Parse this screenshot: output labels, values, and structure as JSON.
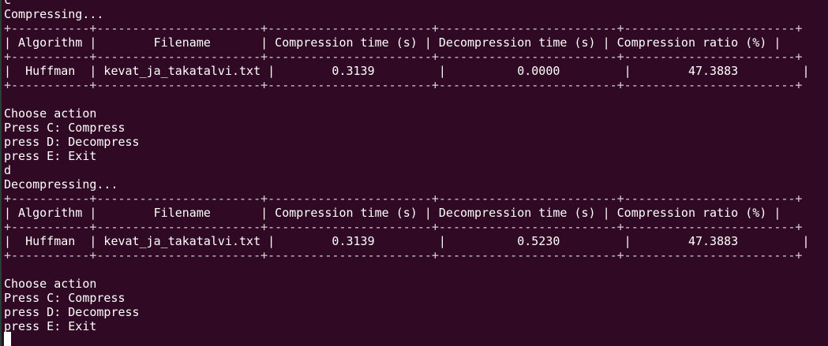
{
  "terminal": {
    "lines": [
      "c",
      "Compressing...",
      "+-----------+-----------------------+-----------------------+-------------------------+------------------------+",
      "| Algorithm |        Filename       | Compression time (s) | Decompression time (s) | Compression ratio (%) |",
      "+-----------+-----------------------+-----------------------+-------------------------+------------------------+",
      "|  Huffman  | kevat_ja_takatalvi.txt |        0.3139         |          0.0000         |        47.3883         |",
      "+-----------+-----------------------+-----------------------+-------------------------+------------------------+",
      "",
      "Choose action",
      "Press C: Compress",
      "press D: Decompress",
      "press E: Exit",
      "d",
      "Decompressing...",
      "+-----------+-----------------------+-----------------------+-------------------------+------------------------+",
      "| Algorithm |        Filename       | Compression time (s) | Decompression time (s) | Compression ratio (%) |",
      "+-----------+-----------------------+-----------------------+-------------------------+------------------------+",
      "|  Huffman  | kevat_ja_takatalvi.txt |        0.3139         |          0.5230         |        47.3883         |",
      "+-----------+-----------------------+-----------------------+-------------------------+------------------------+",
      "",
      "Choose action",
      "Press C: Compress",
      "press D: Decompress",
      "press E: Exit"
    ]
  },
  "colors": {
    "background": "#300a24",
    "text": "#ffffff",
    "border": "#d8d0d6",
    "cursor": "#ffffff"
  }
}
